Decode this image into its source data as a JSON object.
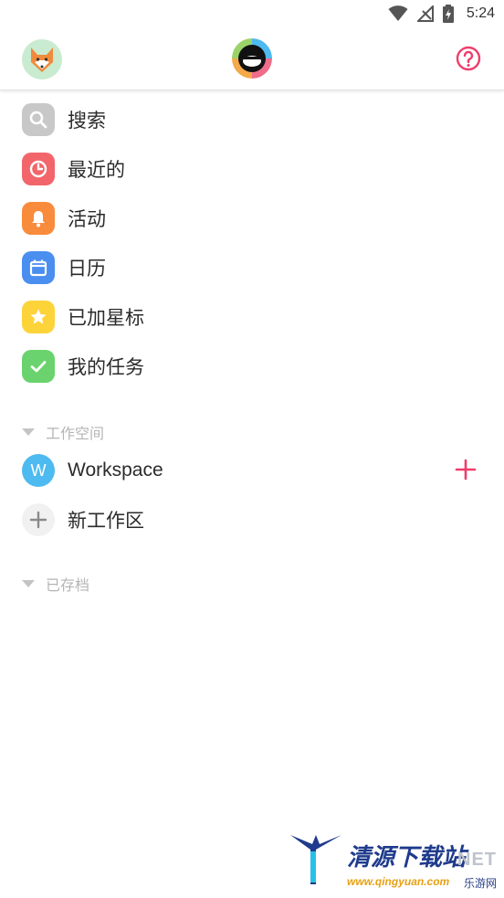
{
  "status_bar": {
    "time": "5:24",
    "icons": [
      "wifi-icon",
      "no-signal-icon",
      "battery-charging-icon"
    ]
  },
  "app_bar": {
    "avatar_icon": "fox-avatar-icon",
    "logo_icon": "app-logo-icon",
    "help_icon": "help-circle-icon"
  },
  "menu": {
    "items": [
      {
        "label": "搜索",
        "icon": "search-icon",
        "color": "#c8c8c8"
      },
      {
        "label": "最近的",
        "icon": "clock-icon",
        "color": "#f2656b"
      },
      {
        "label": "活动",
        "icon": "bell-icon",
        "color": "#f98b3c"
      },
      {
        "label": "日历",
        "icon": "calendar-icon",
        "color": "#4a8ef0"
      },
      {
        "label": "已加星标",
        "icon": "star-icon",
        "color": "#fdd33a"
      },
      {
        "label": "我的任务",
        "icon": "check-icon",
        "color": "#6ad36d"
      }
    ]
  },
  "workspaces": {
    "section_label": "工作空间",
    "items": [
      {
        "badge": "W",
        "label": "Workspace",
        "color": "#4dbaf0"
      }
    ],
    "new_label": "新工作区",
    "accent": "#ef3d6b"
  },
  "archived": {
    "section_label": "已存档"
  },
  "watermark": {
    "title": "清源下载站",
    "url": "www.qingyuan.com",
    "net": "NET",
    "site": "乐游网"
  }
}
